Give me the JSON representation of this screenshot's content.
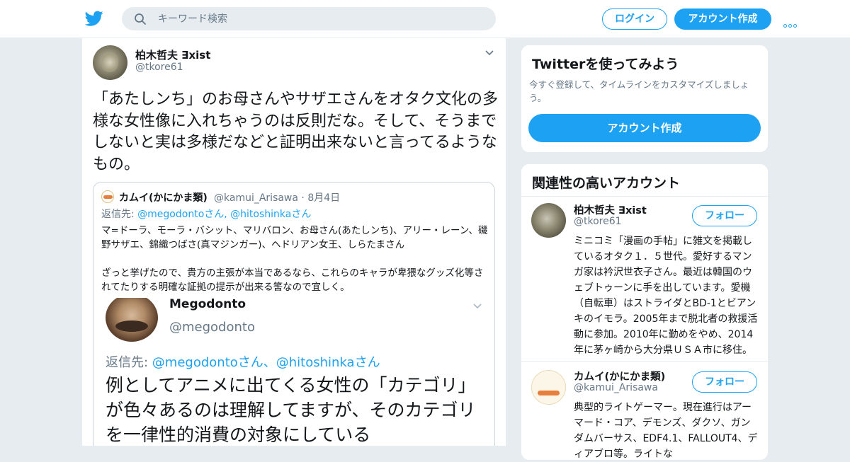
{
  "header": {
    "search_placeholder": "キーワード検索",
    "login_label": "ログイン",
    "signup_label": "アカウント作成",
    "brand_color": "#1da1f2"
  },
  "tweet": {
    "author_name": "柏木哲夫 ∃xist",
    "author_handle": "@tkore61",
    "text": "「あたしンち」のお母さんやサザエさんをオタク文化の多様な女性像に入れちゃうのは反則だな。そして、そうまでしないと実は多様だなどと証明出来ないと言ってるようなもの。",
    "quote": {
      "name": "カムイ(かにかま類)",
      "handle": "@kamui_Arisawa",
      "date": "· 8月4日",
      "reply_prefix": "返信先: ",
      "reply_to": "@megodontoさん, @hitoshinkaさん",
      "paragraph1": "マ=ドーラ、モーラ・バシット、マリバロン、お母さん(あたしンち)、アリー・レーン、磯野サザエ、錦織つばさ(真マジンガー)、ヘドリアン女王、しらたまさん",
      "paragraph2": "ざっと挙げたので、貴方の主張が本当であるなら、これらのキャラが卑猥なグッズ化等されてたりする明確な証拠の提示が出来る筈なので宜しく。",
      "image": {
        "name": "Megodonto",
        "handle": "@megodonto",
        "reply_prefix": "返信先: ",
        "reply_to": "@megodontoさん、@hitoshinkaさん",
        "text": "例としてアニメに出てくる女性の「カテゴリ」が色々あるのは理解してますが、そのカテゴリを一律性的消費の対象にしている"
      }
    }
  },
  "sidebar": {
    "promo": {
      "title": "Twitterを使ってみよう",
      "description": "今すぐ登録して、タイムラインをカスタマイズしましょう。",
      "cta_label": "アカウント作成"
    },
    "related": {
      "title": "関連性の高いアカウント",
      "accounts": [
        {
          "name": "柏木哲夫 ∃xist",
          "handle": "@tkore61",
          "follow_label": "フォロー",
          "bio": "ミニコミ「漫画の手帖」に雑文を掲載しているオタク１．５世代。愛好するマンガ家は衿沢世衣子さん。最近は韓国のウェブトゥーンに手を出しています。愛機（自転車）はストライダとBD-1とビアンキのイモラ。2005年まで脱北者の救援活動に参加。2010年に勤めをやめ、2014年に茅ヶ崎から大分県ＵＳＡ市に移住。"
        },
        {
          "name": "カムイ(かにかま類)",
          "handle": "@kamui_Arisawa",
          "follow_label": "フォロー",
          "bio": "典型的ライトゲーマー。現在進行はアーマード・コア、デモンズ、ダクソ、ガンダムバーサス、EDF4.1、FALLOUT4、ディアブロ等。ライトな"
        }
      ]
    }
  }
}
